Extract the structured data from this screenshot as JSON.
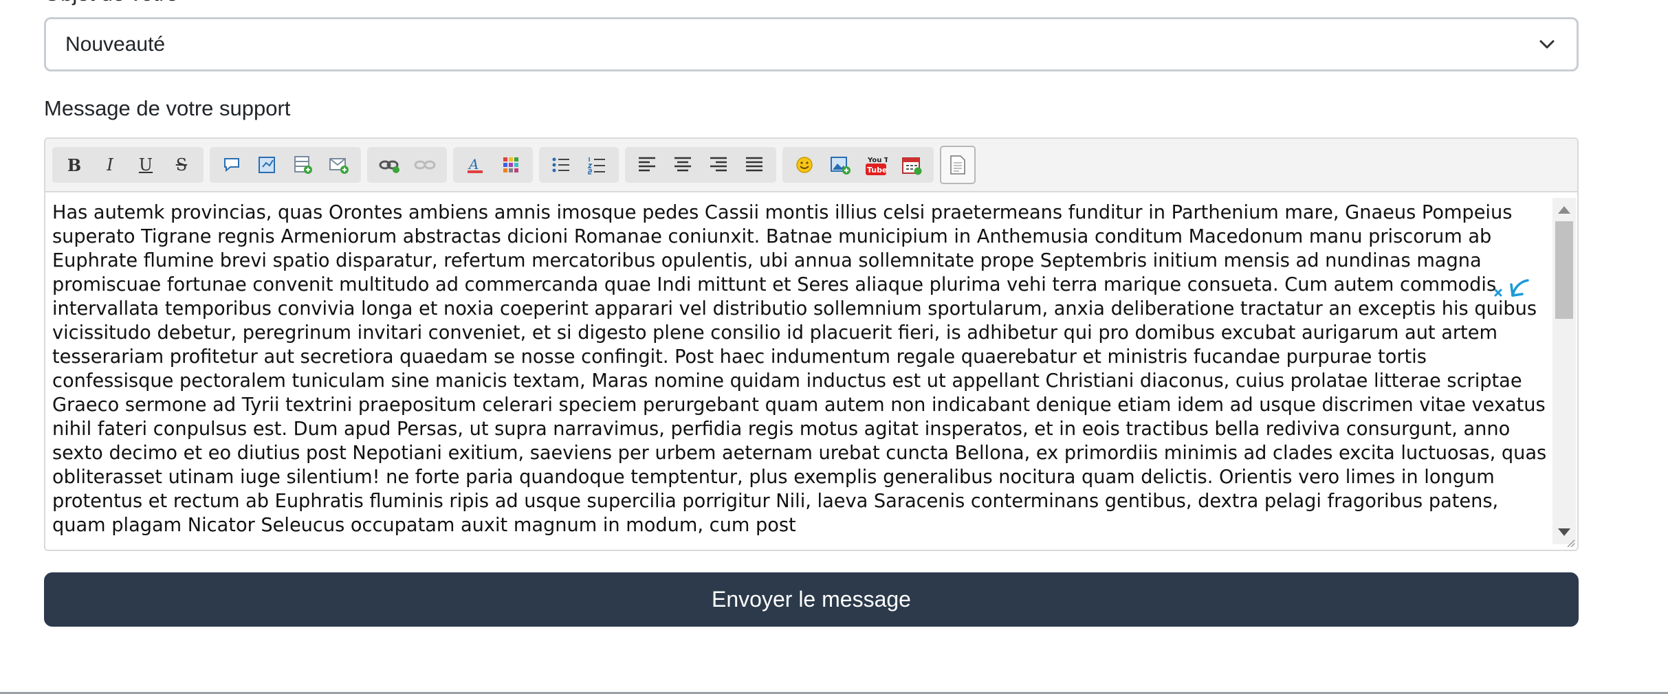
{
  "form": {
    "select_value": "Nouveauté",
    "message_label": "Message de votre support",
    "submit_label": "Envoyer le message"
  },
  "toolbar": {
    "groups": [
      [
        "bold-icon",
        "italic-icon",
        "underline-icon",
        "strikethrough-icon"
      ],
      [
        "quote-icon",
        "code-icon",
        "table-icon",
        "email-icon"
      ],
      [
        "link-icon",
        "unlink-icon"
      ],
      [
        "font-color-icon",
        "background-color-icon"
      ],
      [
        "bullet-list-icon",
        "numbered-list-icon"
      ],
      [
        "align-left-icon",
        "align-center-icon",
        "align-right-icon",
        "justify-icon"
      ],
      [
        "emoji-icon",
        "image-icon",
        "youtube-icon",
        "date-icon"
      ],
      [
        "source-icon"
      ]
    ],
    "labels": {
      "bold": "B",
      "italic": "I",
      "underline": "U",
      "strike": "S",
      "youtube": "You Tube"
    }
  },
  "editor": {
    "content": "Has autemk provincias, quas Orontes ambiens amnis imosque pedes Cassii montis illius celsi praetermeans funditur in Parthenium mare, Gnaeus Pompeius superato Tigrane regnis Armeniorum abstractas dicioni Romanae coniunxit. Batnae municipium in Anthemusia conditum Macedonum manu priscorum ab Euphrate flumine brevi spatio disparatur, refertum mercatoribus opulentis, ubi annua sollemnitate prope Septembris initium mensis ad nundinas magna promiscuae fortunae convenit multitudo ad commercanda quae Indi mittunt et Seres aliaque plurima vehi terra marique consueta. Cum autem commodis intervallata temporibus convivia longa et noxia coeperint apparari vel distributio sollemnium sportularum, anxia deliberatione tractatur an exceptis his quibus vicissitudo debetur, peregrinum invitari conveniet, et si digesto plene consilio id placuerit fieri, is adhibetur qui pro domibus excubat aurigarum aut artem tesserariam profitetur aut secretiora quaedam se nosse confingit. Post haec indumentum regale quaerebatur et ministris fucandae purpurae tortis confessisque pectoralem tuniculam sine manicis textam, Maras nomine quidam inductus est ut appellant Christiani diaconus, cuius prolatae litterae scriptae Graeco sermone ad Tyrii textrini praepositum celerari speciem perurgebant quam autem non indicabant denique etiam idem ad usque discrimen vitae vexatus nihil fateri conpulsus est. Dum apud Persas, ut supra narravimus, perfidia regis motus agitat insperatos, et in eois tractibus bella rediviva consurgunt, anno sexto decimo et eo diutius post Nepotiani exitium, saeviens per urbem aeternam urebat cuncta Bellona, ex primordiis minimis ad clades excita luctuosas, quas obliterasset utinam iuge silentium! ne forte paria quandoque temptentur, plus exemplis generalibus nocitura quam delictis. Orientis vero limes in longum protentus et rectum ab Euphratis fluminis ripis ad usque supercilia porrigitur Nili, laeva Saracenis conterminans gentibus, dextra pelagi fragoribus patens, quam plagam Nicator Seleucus occupatam auxit magnum in modum, cum post"
  },
  "colors": {
    "accent": "#2c3a4b",
    "spellcheck": "#e02020",
    "grammar": "#1a9bd7"
  }
}
